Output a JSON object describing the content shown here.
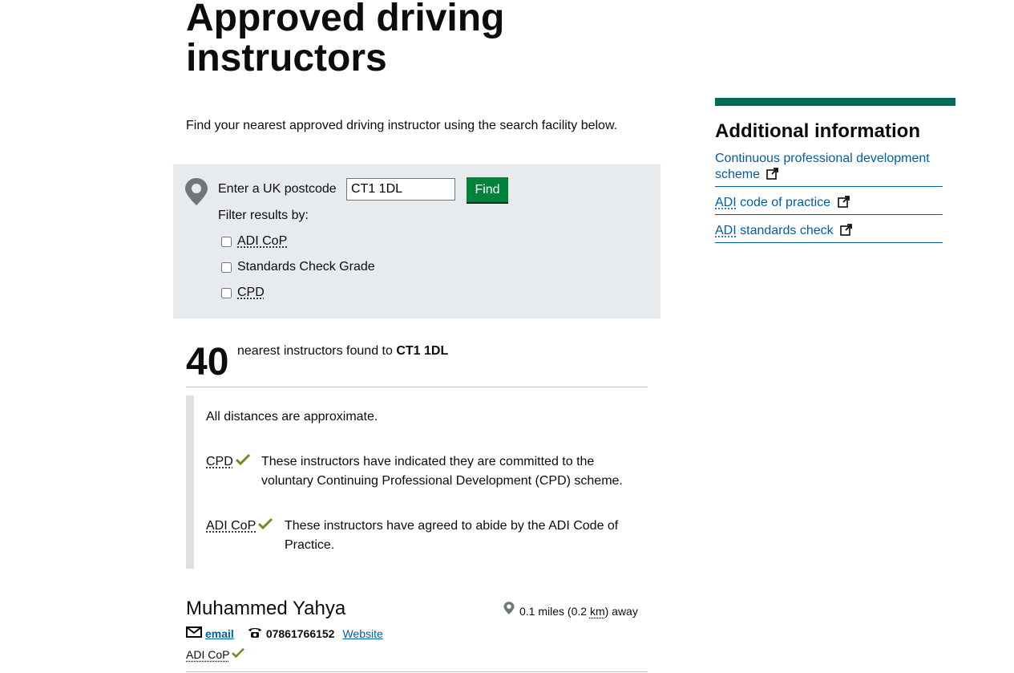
{
  "page": {
    "title": "Approved driving instructors",
    "intro": "Find your nearest approved driving instructor using the search facility below."
  },
  "search": {
    "postcode_label": "Enter a UK postcode",
    "postcode_value": "CT1 1DL",
    "find_label": "Find",
    "filter_label": "Filter results by:",
    "filters": [
      {
        "label": "ADI CoP",
        "checked": false
      },
      {
        "label": "Standards Check Grade",
        "checked": false
      },
      {
        "label": "CPD",
        "checked": false
      }
    ]
  },
  "results": {
    "count": "40",
    "text": "nearest instructors found to",
    "postcode": "CT1 1DL"
  },
  "key": {
    "note": "All distances are approximate.",
    "items": [
      {
        "term": "CPD",
        "desc": "These instructors have indicated they are committed to the voluntary Continuing Professional Development (CPD) scheme."
      },
      {
        "term": "ADI CoP",
        "desc": "These instructors have agreed to abide by the ADI Code of Practice."
      }
    ]
  },
  "instructor": {
    "name": "Muhammed Yahya",
    "distance_prefix": "0.1 miles (0.2",
    "distance_unit": "km",
    "distance_suffix": ") away",
    "email_label": "email",
    "phone": "07861766152",
    "website_label": "Website",
    "badge": "ADI CoP"
  },
  "sidebar": {
    "heading": "Additional information",
    "links": [
      {
        "label": "Continuous professional development scheme"
      },
      {
        "label_abbr": "ADI",
        "label": " code of practice"
      },
      {
        "label_abbr": "ADI",
        "label": " standards check"
      }
    ]
  },
  "colors": {
    "accent_green": "#00823b",
    "sidebar_bar": "#006d5b",
    "link": "#005ea5",
    "panel_bg": "#e8ebed",
    "tick": "#6b8e23"
  },
  "icons": [
    "map-pin-icon",
    "checkmark-icon",
    "envelope-icon",
    "telephone-icon",
    "external-link-icon"
  ]
}
